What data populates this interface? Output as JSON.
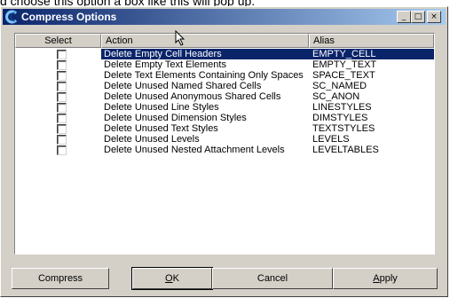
{
  "page": {
    "caption_text": "d choose this option a box like this will pop up."
  },
  "window": {
    "title": "Compress Options",
    "icon": "microstation-icon",
    "controls": {
      "minimize": "_",
      "maximize": "□",
      "close": "×"
    }
  },
  "table": {
    "headers": {
      "select": "Select",
      "action": "Action",
      "alias": "Alias"
    },
    "rows": [
      {
        "action": "Delete Empty Cell Headers",
        "alias": "EMPTY_CELL",
        "selected": true
      },
      {
        "action": "Delete Empty Text Elements",
        "alias": "EMPTY_TEXT"
      },
      {
        "action": "Delete Text Elements Containing Only Spaces",
        "alias": "SPACE_TEXT"
      },
      {
        "action": "Delete Unused Named Shared Cells",
        "alias": "SC_NAMED"
      },
      {
        "action": "Delete Unused Anonymous Shared Cells",
        "alias": "SC_ANON"
      },
      {
        "action": "Delete Unused Line Styles",
        "alias": "LINESTYLES"
      },
      {
        "action": "Delete Unused Dimension Styles",
        "alias": "DIMSTYLES"
      },
      {
        "action": "Delete Unused Text Styles",
        "alias": "TEXTSTYLES"
      },
      {
        "action": "Delete Unused Levels",
        "alias": "LEVELS"
      },
      {
        "action": "Delete Unused Nested Attachment Levels",
        "alias": "LEVELTABLES"
      }
    ]
  },
  "buttons": {
    "compress": "Compress",
    "ok": "OK",
    "cancel": "Cancel",
    "apply": "Apply"
  },
  "colors": {
    "selection": "#0a246a",
    "dialog_face": "#d4d0c8"
  }
}
